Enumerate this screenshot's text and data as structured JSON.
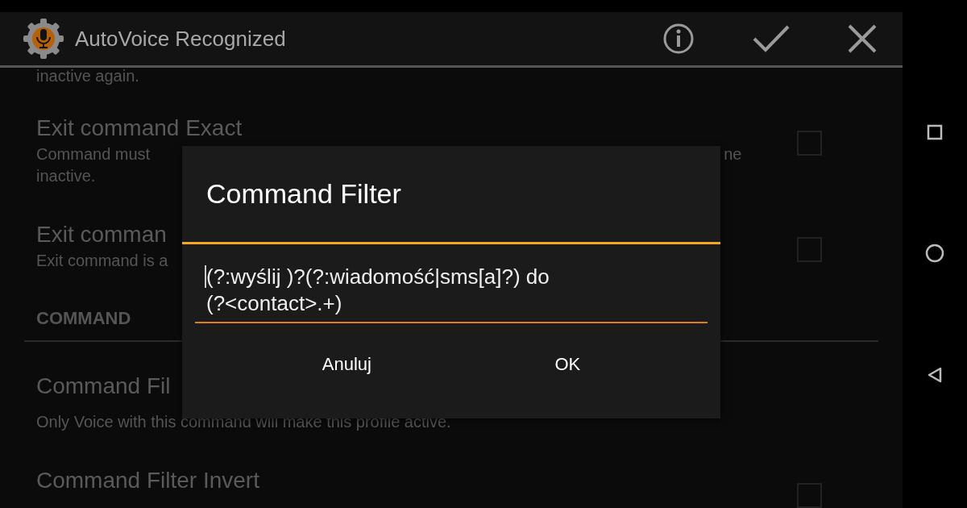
{
  "app_bar": {
    "title": "AutoVoice Recognized"
  },
  "settings": [
    {
      "kind": "fragment",
      "description": [
        "inactive again."
      ]
    },
    {
      "kind": "setting",
      "title": "Exit command Exact",
      "description": [
        "Command must",
        "inactive."
      ],
      "description_tail": "ne",
      "checked": false
    },
    {
      "kind": "setting",
      "title": "Exit comman",
      "description": [
        "Exit command is a"
      ],
      "checked": false
    },
    {
      "kind": "header",
      "title": "COMMAND"
    },
    {
      "kind": "setting",
      "title": "Command Fil",
      "description": [
        "Only Voice with this command will make this profile active."
      ]
    },
    {
      "kind": "setting",
      "title": "Command Filter Invert",
      "checked": false
    }
  ],
  "dialog": {
    "title": "Command Filter",
    "value": "(?:wyślij )?(?:wiadomość|sms[a]?) do (?<contact>.+)",
    "buttons": [
      "Anuluj",
      "OK"
    ]
  }
}
